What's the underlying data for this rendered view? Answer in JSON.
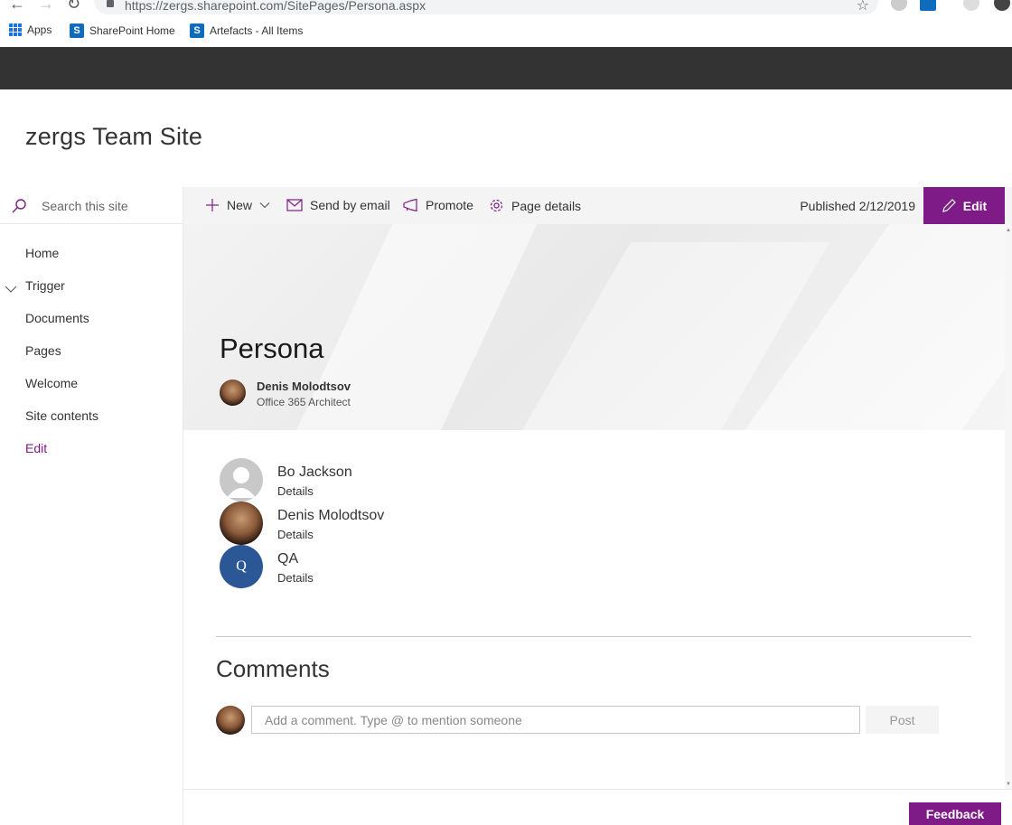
{
  "browser": {
    "url": "https://zergs.sharepoint.com/SitePages/Persona.aspx",
    "bookmarks": [
      {
        "label": "Apps",
        "icon": "apps-grid-icon"
      },
      {
        "label": "SharePoint Home",
        "icon": "sharepoint-icon"
      },
      {
        "label": "Artefacts - All Items",
        "icon": "sharepoint-icon"
      }
    ]
  },
  "site": {
    "title": "zergs Team Site"
  },
  "search": {
    "placeholder": "Search this site"
  },
  "nav": {
    "items": [
      {
        "label": "Home"
      },
      {
        "label": "Trigger"
      },
      {
        "label": "Documents"
      },
      {
        "label": "Pages"
      },
      {
        "label": "Welcome"
      },
      {
        "label": "Site contents"
      },
      {
        "label": "Edit"
      }
    ]
  },
  "commandbar": {
    "new_label": "New",
    "email_label": "Send by email",
    "promote_label": "Promote",
    "details_label": "Page details",
    "published": "Published 2/12/2019",
    "edit_label": "Edit"
  },
  "page": {
    "title": "Persona",
    "author_name": "Denis Molodtsov",
    "author_role": "Office 365 Architect"
  },
  "people": [
    {
      "name": "Bo Jackson",
      "details": "Details"
    },
    {
      "name": "Denis Molodtsov",
      "details": "Details"
    },
    {
      "name": "QA",
      "details": "Details",
      "initials": "Q"
    }
  ],
  "comments": {
    "title": "Comments",
    "placeholder": "Add a comment. Type @ to mention someone",
    "post_label": "Post"
  },
  "feedback": {
    "label": "Feedback"
  },
  "colors": {
    "accent": "#7e1b87",
    "suitebar": "#333333",
    "qa_avatar": "#2b5797"
  }
}
